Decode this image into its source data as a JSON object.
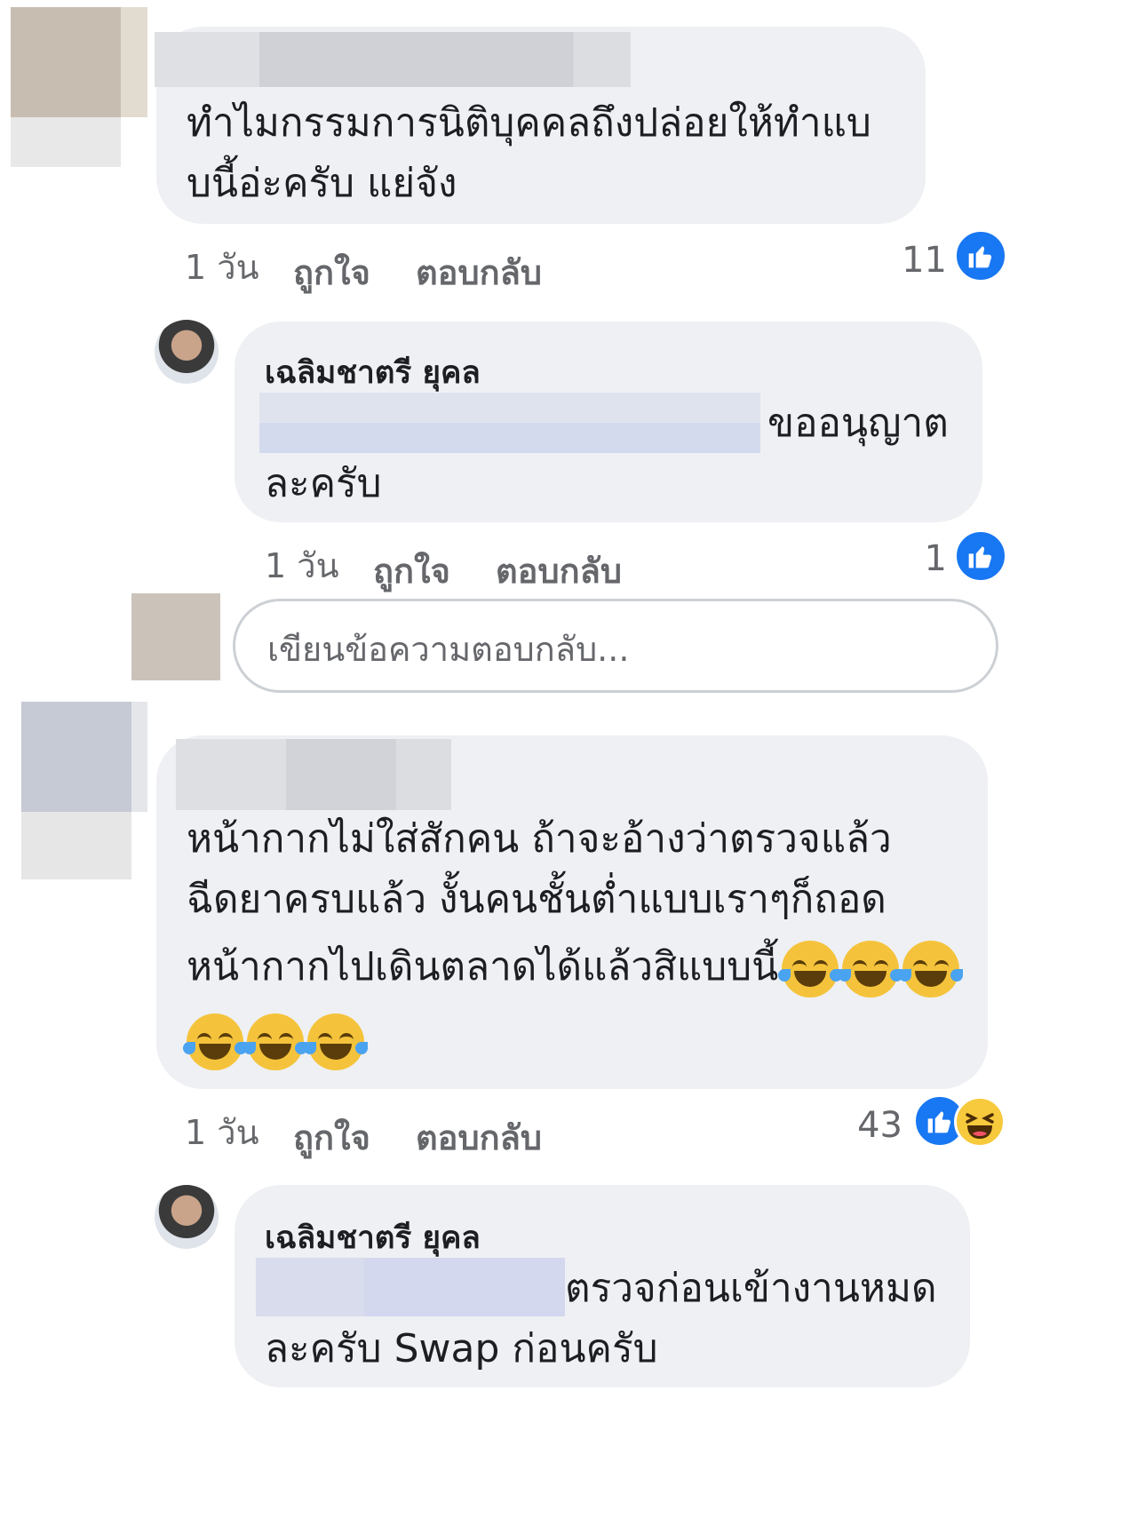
{
  "comments": [
    {
      "text_lines": [
        "ทำไมกรรมการนิติบุคคลถึงปล่อยให้ทำแบ",
        "บนี้อ่ะครับ แย่จัง"
      ],
      "time": "1 วัน",
      "like_label": "ถูกใจ",
      "reply_label": "ตอบกลับ",
      "reaction_count": "11",
      "reactions": [
        "like-icon"
      ],
      "colors": {
        "avatar_top": "#c9bfb3",
        "avatar_bottom": "#e7e7e7",
        "name_blur": "#d5d6da"
      }
    },
    {
      "author": "เฉลิมชาตรี ยุคล",
      "text_line1": "ขออนุญาต",
      "text_line2": "ละครับ",
      "time": "1 วัน",
      "like_label": "ถูกใจ",
      "reply_label": "ตอบกลับ",
      "reaction_count": "1",
      "reactions": [
        "like-icon"
      ]
    },
    {
      "text_lines": [
        "หน้ากากไม่ใส่สักคน ถ้าจะอ้างว่าตรวจแล้ว",
        "ฉีดยาครบแล้ว งั้นคนชั้นต่ำแบบเราๆก็ถอด",
        "หน้ากากไปเดินตลาดได้แล้วสิแบบนี้"
      ],
      "emoji": "face-with-tears-of-joy",
      "time": "1 วัน",
      "like_label": "ถูกใจ",
      "reply_label": "ตอบกลับ",
      "reaction_count": "43",
      "reactions": [
        "like-icon",
        "haha-icon"
      ],
      "colors": {
        "avatar_top": "#c6cad4",
        "avatar_bottom": "#e6e6e6",
        "name_blur": "#d3d5d9"
      }
    },
    {
      "author": "เฉลิมชาตรี ยุคล",
      "text_line1": "ตรวจก่อนเข้างานหมด",
      "text_line2": "ละครับ Swap ก่อนครับ"
    }
  ],
  "reply_box": {
    "placeholder": "เขียนข้อความตอบกลับ..."
  },
  "colors": {
    "bubble": "#eef0f3",
    "meta_text": "#65676b",
    "like_blue": "#1877f2",
    "mention_blur": "#d6ddef",
    "haha_yellow": "#f7c93c"
  }
}
